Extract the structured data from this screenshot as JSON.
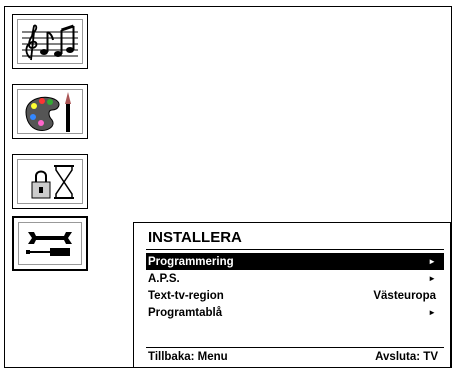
{
  "sidebar": [
    {
      "icon": "music-notes-icon"
    },
    {
      "icon": "paint-palette-icon"
    },
    {
      "icon": "lock-hourglass-icon"
    },
    {
      "icon": "wrench-screwdriver-icon",
      "selected": true
    }
  ],
  "menu": {
    "title": "INSTALLERA",
    "items": [
      {
        "label": "Programmering",
        "value": "",
        "arrow": "►"
      },
      {
        "label": "A.P.S.",
        "value": "",
        "arrow": "►"
      },
      {
        "label": "Text-tv-region",
        "value": "Västeuropa",
        "arrow": ""
      },
      {
        "label": "Programtablå",
        "value": "",
        "arrow": "►"
      }
    ],
    "footer": {
      "back": "Tillbaka: Menu",
      "exit": "Avsluta: TV"
    }
  },
  "colors": {
    "selected_bg": "#000000",
    "selected_fg": "#ffffff"
  }
}
